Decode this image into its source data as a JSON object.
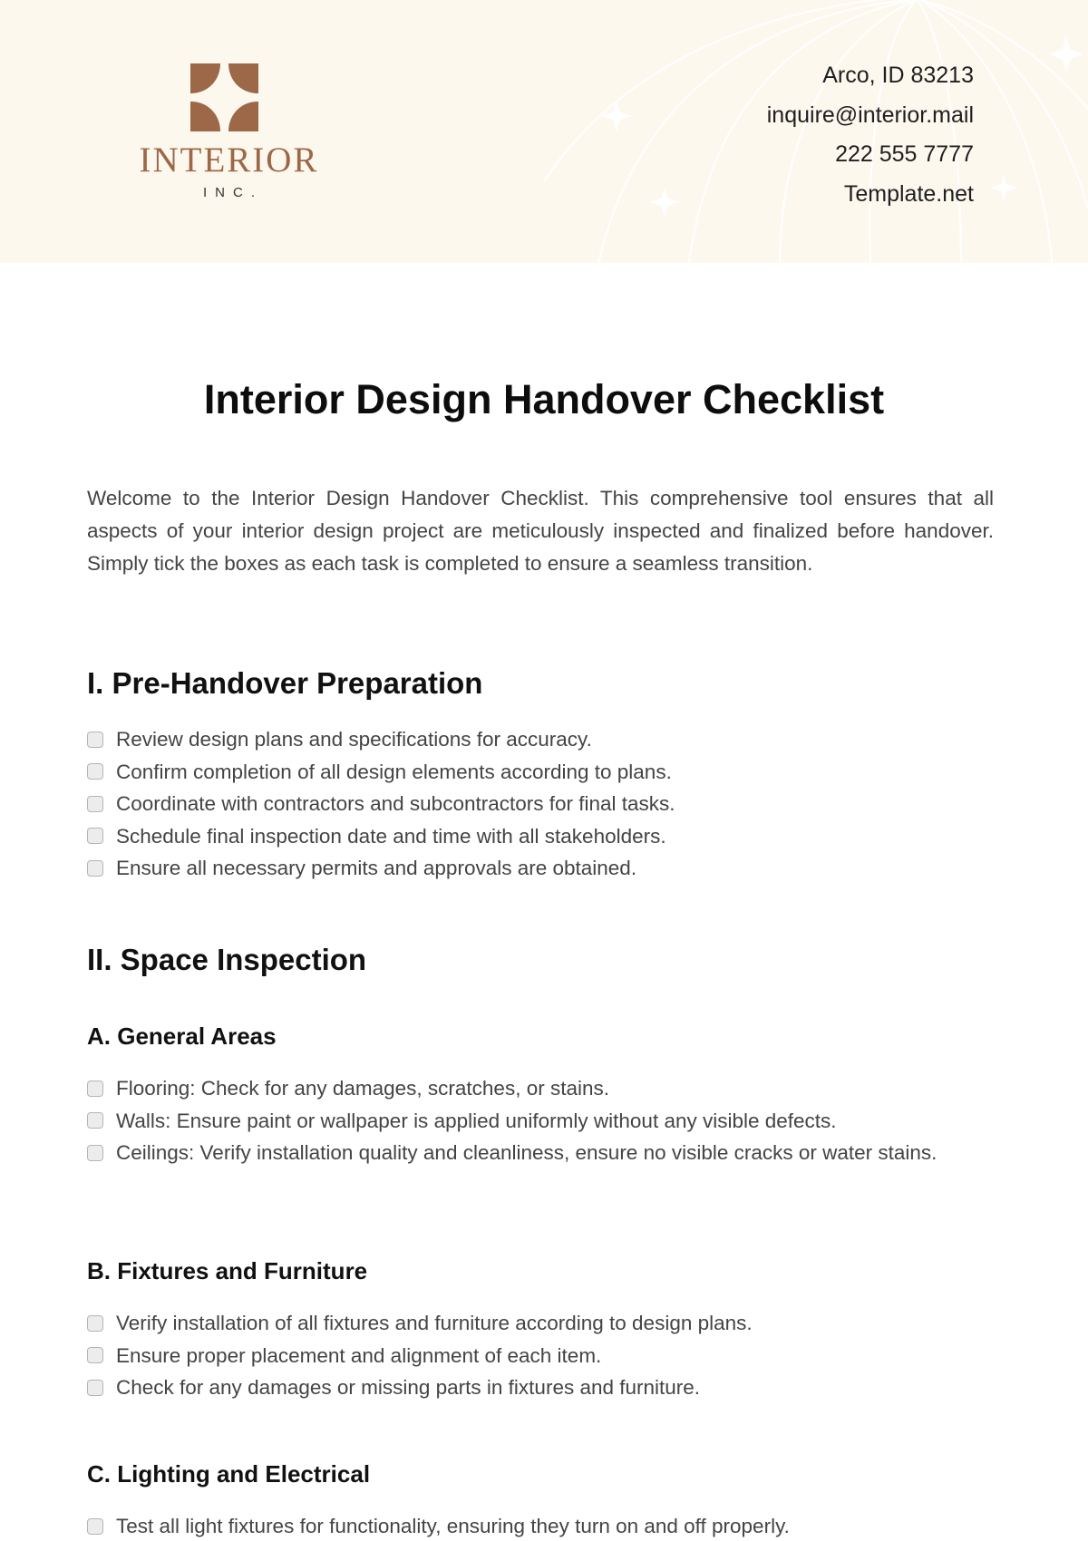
{
  "header": {
    "logo": {
      "wordmark": "INTERIOR",
      "subtitle": "INC.",
      "brand_color": "#9c6847"
    },
    "contact": {
      "address": "Arco, ID 83213",
      "email": "inquire@interior.mail",
      "phone": "222 555 7777",
      "website": "Template.net"
    },
    "background_color": "#fdf8ee"
  },
  "document": {
    "title": "Interior Design Handover Checklist",
    "intro": "Welcome to the Interior Design Handover Checklist. This comprehensive tool ensures that all aspects of your interior design project are meticulously inspected and finalized before handover. Simply tick the boxes as each task is completed to ensure a seamless transition.",
    "sections": [
      {
        "heading": "I. Pre-Handover Preparation",
        "items": [
          {
            "text": "Review design plans and specifications for accuracy.",
            "checked": false
          },
          {
            "text": "Confirm completion of all design elements according to plans.",
            "checked": false
          },
          {
            "text": "Coordinate with contractors and subcontractors for final tasks.",
            "checked": false
          },
          {
            "text": "Schedule final inspection date and time with all stakeholders.",
            "checked": false
          },
          {
            "text": "Ensure all necessary permits and approvals are obtained.",
            "checked": false
          }
        ]
      },
      {
        "heading": "II. Space Inspection",
        "subsections": [
          {
            "heading": "A. General Areas",
            "items": [
              {
                "text": "Flooring: Check for any damages, scratches, or stains.",
                "checked": false
              },
              {
                "text": "Walls: Ensure paint or wallpaper is applied uniformly without any visible defects.",
                "checked": false
              },
              {
                "text": "Ceilings: Verify installation quality and cleanliness, ensure no visible cracks or water stains.",
                "checked": false
              }
            ]
          },
          {
            "heading": "B. Fixtures and Furniture",
            "items": [
              {
                "text": "Verify installation of all fixtures and furniture according to design plans.",
                "checked": false
              },
              {
                "text": "Ensure proper placement and alignment of each item.",
                "checked": false
              },
              {
                "text": "Check for any damages or missing parts in fixtures and furniture.",
                "checked": false
              }
            ]
          },
          {
            "heading": "C. Lighting and Electrical",
            "items": [
              {
                "text": "Test all light fixtures for functionality, ensuring they turn on and off properly.",
                "checked": false
              }
            ]
          }
        ]
      }
    ]
  }
}
